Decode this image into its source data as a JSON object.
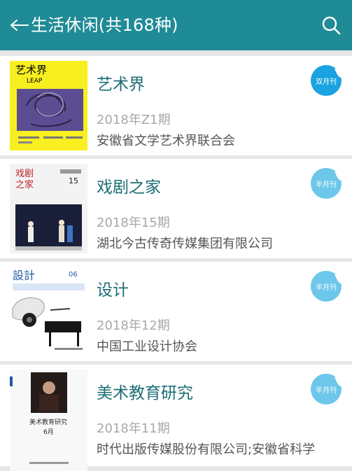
{
  "header": {
    "title": "生活休闲(共168种)",
    "back_icon": "back-arrow-icon",
    "search_icon": "search-icon",
    "bar_color": "#1f8b96"
  },
  "magazines": [
    {
      "title": "艺术界",
      "issue": "2018年Z1期",
      "publisher": "安徽省文学艺术界联合会",
      "badge_text": "双月刊",
      "badge_color": "#1aa3e0",
      "cover_text": "艺术界 LEAP"
    },
    {
      "title": "戏剧之家",
      "issue": "2018年15期",
      "publisher": "湖北今古传奇传媒集团有限公司",
      "badge_text": "半月刊",
      "badge_color": "#6cc7ea",
      "cover_text": "戏剧之家 15"
    },
    {
      "title": "设计",
      "issue": "2018年12期",
      "publisher": "中国工业设计协会",
      "badge_text": "半月刊",
      "badge_color": "#6cc7ea",
      "cover_text": "設計 06"
    },
    {
      "title": "美术教育研究",
      "issue": "2018年11期",
      "publisher": "时代出版传媒股份有限公司;安徽省科学",
      "badge_text": "半月刊",
      "badge_color": "#6cc7ea",
      "cover_text": "美术教育研究"
    }
  ]
}
